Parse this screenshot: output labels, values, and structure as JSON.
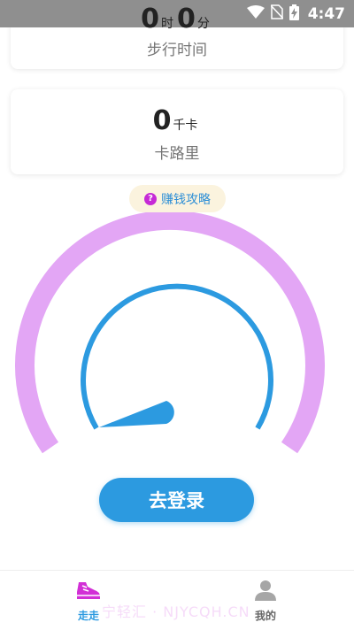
{
  "status_bar": {
    "time": "4:47",
    "icons": [
      "wifi-icon",
      "no-sim-icon",
      "battery-charging-icon"
    ]
  },
  "walk_card": {
    "hours_value": "0",
    "hours_unit": "时",
    "minutes_value": "0",
    "minutes_unit": "分",
    "label": "步行时间"
  },
  "calorie_card": {
    "value": "0",
    "unit": "千卡",
    "label": "卡路里"
  },
  "strategy_button": {
    "label": "赚钱攻略",
    "icon": "question-circle-icon"
  },
  "gauge": {
    "level": 0,
    "colors": {
      "outer_arc": "#e3a6f5",
      "inner_arc": "#2c9ae0",
      "needle": "#2c9ae0"
    }
  },
  "login_button": {
    "label": "去登录"
  },
  "bottom_nav": {
    "items": [
      {
        "label": "走走",
        "icon": "sneaker-icon",
        "active": true
      },
      {
        "label": "我的",
        "icon": "user-icon",
        "active": false
      }
    ]
  },
  "watermark": {
    "text": "宁轻汇 · NJYCQH.CN"
  },
  "colors": {
    "accent": "#2c9ae0",
    "status_bar": "#8f8f8f",
    "pill_bg": "#fbf3de"
  }
}
